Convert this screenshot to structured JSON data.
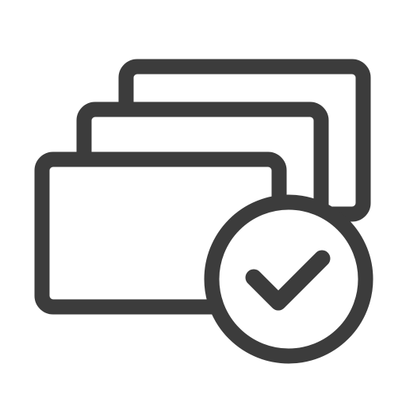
{
  "icon": {
    "name": "stacked-cards-with-checkmark-icon",
    "stroke_color": "#3c3c3c",
    "background_color": "#ffffff",
    "card_count": 3,
    "badge": "checkmark"
  }
}
